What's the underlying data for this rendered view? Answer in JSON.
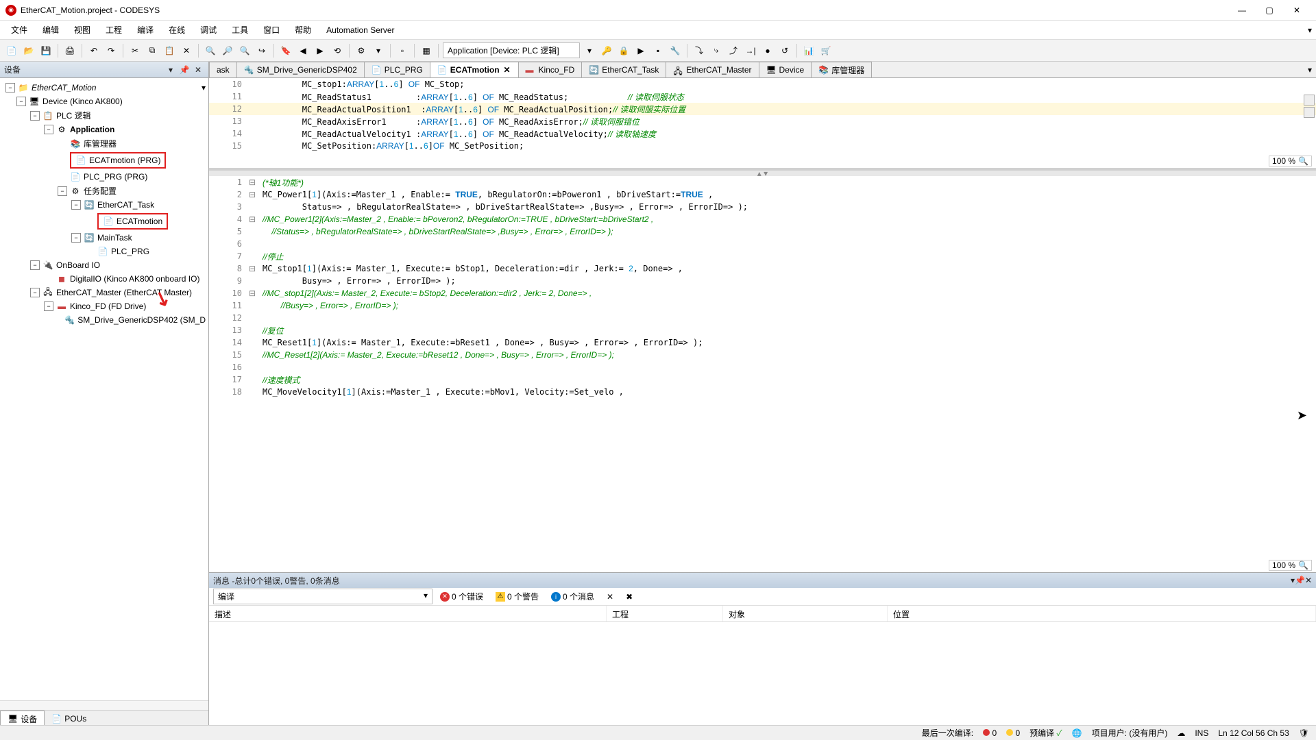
{
  "window": {
    "title": "EtherCAT_Motion.project - CODESYS"
  },
  "menu": [
    "文件",
    "编辑",
    "视图",
    "工程",
    "编译",
    "在线",
    "调试",
    "工具",
    "窗口",
    "帮助",
    "Automation Server"
  ],
  "toolbar": {
    "app_combo": "Application [Device: PLC 逻辑]"
  },
  "device_panel": {
    "title": "设备",
    "tree": {
      "root": "EtherCAT_Motion",
      "device": "Device (Kinco AK800)",
      "plc_logic": "PLC 逻辑",
      "application": "Application",
      "lib_mgr": "库管理器",
      "ecat_motion_prg": "ECATmotion (PRG)",
      "plc_prg": "PLC_PRG (PRG)",
      "task_cfg": "任务配置",
      "ecat_task": "EtherCAT_Task",
      "ecat_motion_task": "ECATmotion",
      "main_task": "MainTask",
      "plc_prg_task": "PLC_PRG",
      "onboard_io": "OnBoard IO",
      "digital_io": "DigitalIO (Kinco AK800 onboard IO)",
      "ecat_master": "EtherCAT_Master (EtherCAT Master)",
      "kinco_fd": "Kinco_FD (FD Drive)",
      "sm_drive": "SM_Drive_GenericDSP402 (SM_D"
    },
    "tabs": {
      "devices": "设备",
      "pous": "POUs"
    }
  },
  "editor_tabs": [
    {
      "label": "Task"
    },
    {
      "label": "SM_Drive_GenericDSP402"
    },
    {
      "label": "PLC_PRG"
    },
    {
      "label": "ECATmotion",
      "active": true
    },
    {
      "label": "Kinco_FD"
    },
    {
      "label": "EtherCAT_Task"
    },
    {
      "label": "EtherCAT_Master"
    },
    {
      "label": "Device"
    },
    {
      "label": "库管理器"
    }
  ],
  "code_top": [
    {
      "n": 10,
      "text": "        MC_stop1:ARRAY[1..6] OF MC_Stop;"
    },
    {
      "n": 11,
      "text": "        MC_ReadStatus1         :ARRAY[1..6] OF MC_ReadStatus;            // 读取伺服状态"
    },
    {
      "n": 12,
      "text": "        MC_ReadActualPosition1  :ARRAY[1..6] OF MC_ReadActualPosition;// 读取伺服实际位置",
      "hl": true
    },
    {
      "n": 13,
      "text": "        MC_ReadAxisError1      :ARRAY[1..6] OF MC_ReadAxisError;// 读取伺服错位"
    },
    {
      "n": 14,
      "text": "        MC_ReadActualVelocity1 :ARRAY[1..6] OF MC_ReadActualVelocity;// 读取轴速度"
    },
    {
      "n": 15,
      "text": "        MC_SetPosition:ARRAY[1..6]OF MC_SetPosition;"
    }
  ],
  "code_bottom": [
    {
      "n": 1,
      "text": "(*轴1功能*)"
    },
    {
      "n": 2,
      "text": "MC_Power1[1](Axis:=Master_1 , Enable:= TRUE, bRegulatorOn:=bPoweron1 , bDriveStart:=TRUE ,"
    },
    {
      "n": 3,
      "text": "        Status=> , bRegulatorRealState=> , bDriveStartRealState=> ,Busy=> , Error=> , ErrorID=> );"
    },
    {
      "n": 4,
      "text": "//MC_Power1[2](Axis:=Master_2 , Enable:= bPoveron2, bRegulatorOn:=TRUE , bDriveStart:=bDriveStart2 ,"
    },
    {
      "n": 5,
      "text": "    //Status=> , bRegulatorRealState=> , bDriveStartRealState=> ,Busy=> , Error=> , ErrorID=> );"
    },
    {
      "n": 6,
      "text": ""
    },
    {
      "n": 7,
      "text": "//停止"
    },
    {
      "n": 8,
      "text": "MC_stop1[1](Axis:= Master_1, Execute:= bStop1, Deceleration:=dir , Jerk:= 2, Done=> ,"
    },
    {
      "n": 9,
      "text": "        Busy=> , Error=> , ErrorID=> );"
    },
    {
      "n": 10,
      "text": "//MC_stop1[2](Axis:= Master_2, Execute:= bStop2, Deceleration:=dir2 , Jerk:= 2, Done=> ,"
    },
    {
      "n": 11,
      "text": "        //Busy=> , Error=> , ErrorID=> );"
    },
    {
      "n": 12,
      "text": ""
    },
    {
      "n": 13,
      "text": "//复位"
    },
    {
      "n": 14,
      "text": "MC_Reset1[1](Axis:= Master_1, Execute:=bReset1 , Done=> , Busy=> , Error=> , ErrorID=> );"
    },
    {
      "n": 15,
      "text": "//MC_Reset1[2](Axis:= Master_2, Execute:=bReset12 , Done=> , Busy=> , Error=> , ErrorID=> );"
    },
    {
      "n": 16,
      "text": ""
    },
    {
      "n": 17,
      "text": "//速度模式"
    },
    {
      "n": 18,
      "text": "MC_MoveVelocity1[1](Axis:=Master_1 , Execute:=bMov1, Velocity:=Set_velo ,"
    }
  ],
  "zoom": {
    "top": "100 %",
    "bottom": "100 %"
  },
  "messages": {
    "header": "消息 -总计0个错误, 0警告, 0条消息",
    "category": "编译",
    "errors": "0 个错误",
    "warnings": "0 个警告",
    "infos": "0 个消息",
    "cols": {
      "desc": "描述",
      "project": "工程",
      "object": "对象",
      "position": "位置"
    }
  },
  "status": {
    "last_compile": "最后一次编译:",
    "err": "0",
    "warn": "0",
    "precompile": "预编译",
    "user": "项目用户: (没有用户)",
    "ins": "INS",
    "pos": "Ln 12   Col 56   Ch 53"
  }
}
